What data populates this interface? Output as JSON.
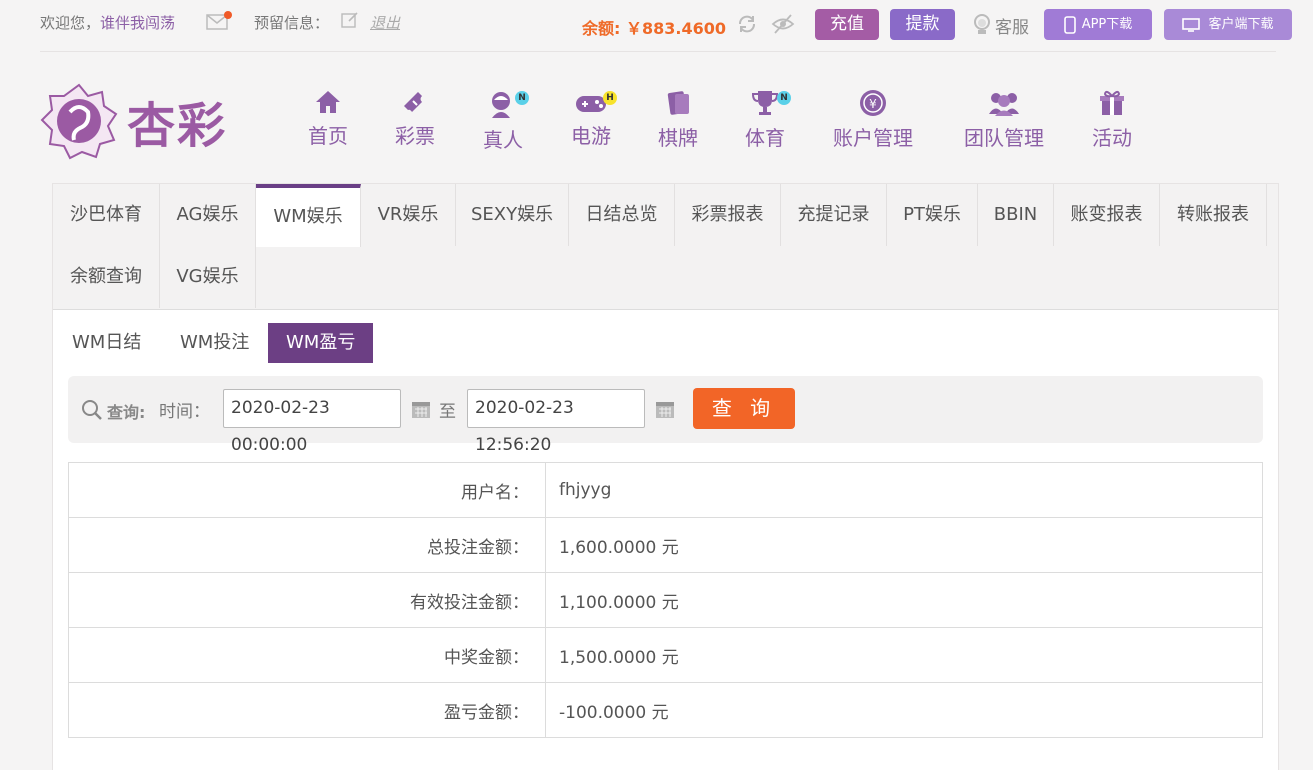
{
  "topbar": {
    "welcome": "欢迎您，",
    "username": "谁伴我闯荡",
    "reserve_label": "预留信息：",
    "logout": "退出",
    "balance_label": "余额:",
    "balance_value": "￥883.4600",
    "charge": "充值",
    "withdraw": "提款",
    "service": "客服",
    "app_download": "APP下载",
    "client_download": "客户端下载"
  },
  "logo": {
    "text": "杏彩"
  },
  "nav": [
    {
      "label": "首页"
    },
    {
      "label": "彩票"
    },
    {
      "label": "真人",
      "badge": "N"
    },
    {
      "label": "电游",
      "badge": "H"
    },
    {
      "label": "棋牌"
    },
    {
      "label": "体育",
      "badge": "N"
    },
    {
      "label": "账户管理"
    },
    {
      "label": "团队管理"
    },
    {
      "label": "活动"
    }
  ],
  "tabs": [
    "沙巴体育",
    "AG娱乐",
    "WM娱乐",
    "VR娱乐",
    "SEXY娱乐",
    "日结总览",
    "彩票报表",
    "充提记录",
    "PT娱乐",
    "BBIN",
    "账变报表",
    "转账报表",
    "余额查询",
    "VG娱乐"
  ],
  "active_tab": "WM娱乐",
  "subtabs": [
    "WM日结",
    "WM投注",
    "WM盈亏"
  ],
  "active_subtab": "WM盈亏",
  "query": {
    "label": "查询:",
    "time_label": "时间：",
    "start": "2020-02-23 00:00:00",
    "to": "至",
    "end": "2020-02-23 12:56:20",
    "button": "查 询"
  },
  "result": {
    "rows": [
      {
        "key": "用户名：",
        "value": "fhjyyg"
      },
      {
        "key": "总投注金额：",
        "value": "1,600.0000 元"
      },
      {
        "key": "有效投注金额：",
        "value": "1,100.0000 元"
      },
      {
        "key": "中奖金额：",
        "value": "1,500.0000 元"
      },
      {
        "key": "盈亏金额：",
        "value": "-100.0000 元"
      }
    ]
  },
  "colors": {
    "brand": "#9b5aa3",
    "accent": "#f26527",
    "active_tab": "#6a3f86"
  }
}
